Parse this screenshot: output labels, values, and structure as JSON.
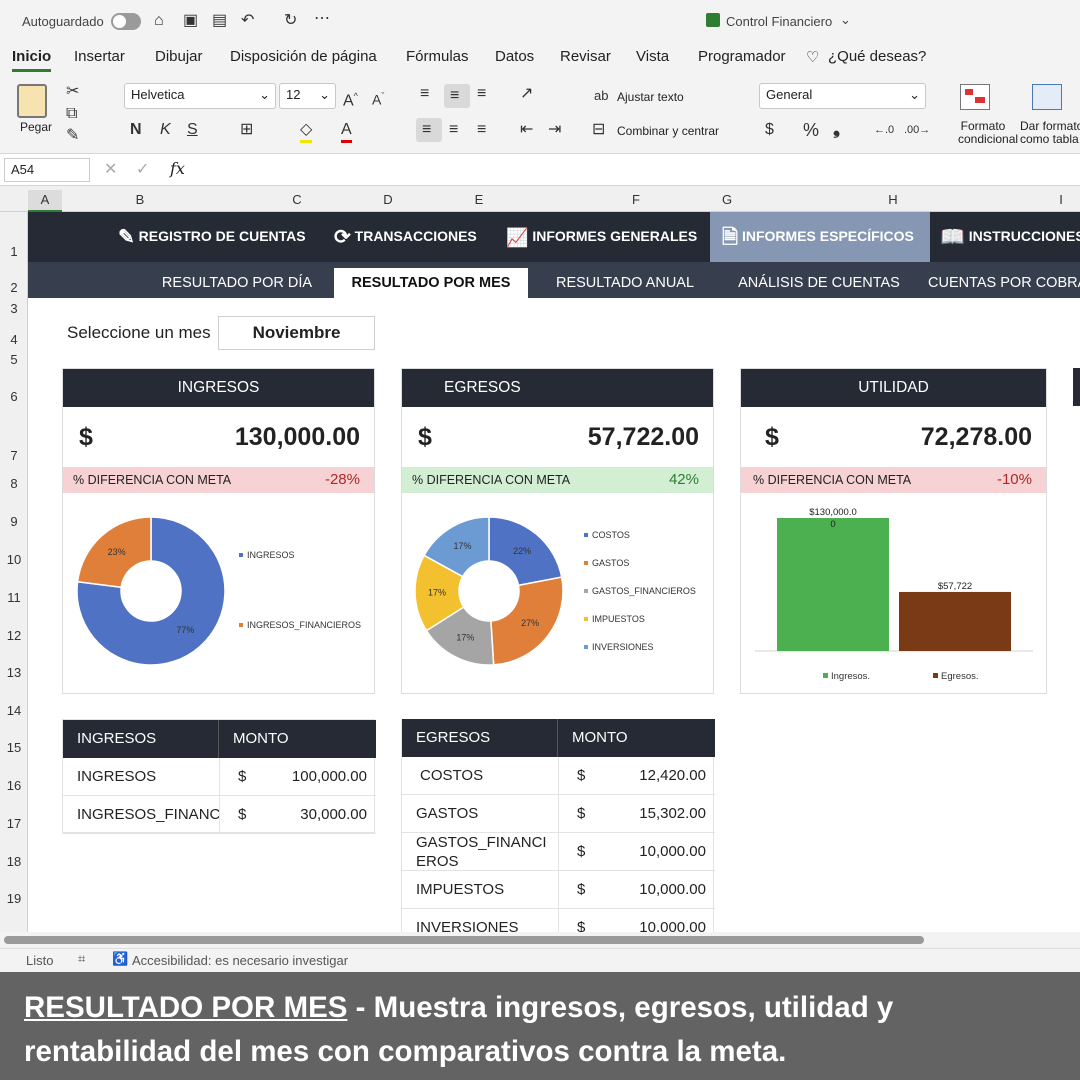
{
  "titlebar": {
    "autosave": "Autoguardado",
    "doc_title": "Control Financiero"
  },
  "tabs": [
    "Inicio",
    "Insertar",
    "Dibujar",
    "Disposición de página",
    "Fórmulas",
    "Datos",
    "Revisar",
    "Vista",
    "Programador",
    "¿Qué deseas?"
  ],
  "ribbon": {
    "paste": "Pegar",
    "font": "Helvetica",
    "size": "12",
    "bold": "N",
    "italic": "K",
    "underline": "S",
    "wrap": "Ajustar texto",
    "merge": "Combinar y centrar",
    "format": "General",
    "currency": "$",
    "percent": "%",
    "comma": "❟",
    "cond1": "Formato",
    "cond2": "condicional",
    "table1": "Dar formato",
    "table2": "como tabla"
  },
  "formula": {
    "cell_ref": "A54",
    "fx": "fx"
  },
  "columns": [
    "A",
    "B",
    "C",
    "D",
    "E",
    "F",
    "G",
    "H",
    "I"
  ],
  "rows": [
    "1",
    "2",
    "3",
    "4",
    "5",
    "6",
    "7",
    "8",
    "9",
    "10",
    "11",
    "12",
    "13",
    "14",
    "15",
    "16",
    "17",
    "18",
    "19"
  ],
  "nav_main": [
    "REGISTRO DE CUENTAS",
    "TRANSACCIONES",
    "INFORMES GENERALES",
    "INFORMES ESPECÍFICOS",
    "INSTRUCCIONES"
  ],
  "nav_sub": [
    "RESULTADO POR DÍA",
    "RESULTADO POR MES",
    "RESULTADO ANUAL",
    "ANÁLISIS DE CUENTAS",
    "CUENTAS POR COBRAR"
  ],
  "month": {
    "label": "Seleccione un mes",
    "value": "Noviembre"
  },
  "cards": [
    {
      "title": "INGRESOS",
      "currency": "$",
      "amount": "130,000.00",
      "diff_label": "% DIFERENCIA CON META",
      "diff_value": "-28%",
      "status_color": "#f6d2d4",
      "value_color": "#b02828"
    },
    {
      "title": "EGRESOS",
      "currency": "$",
      "amount": "57,722.00",
      "diff_label": "% DIFERENCIA CON META",
      "diff_value": "42%",
      "status_color": "#d3efd3",
      "value_color": "#2e7d32"
    },
    {
      "title": "UTILIDAD",
      "currency": "$",
      "amount": "72,278.00",
      "diff_label": "% DIFERENCIA CON META",
      "diff_value": "-10%",
      "status_color": "#f6d2d4",
      "value_color": "#b02828"
    }
  ],
  "chart_data": [
    {
      "type": "pie",
      "donut": true,
      "labels": [
        "INGRESOS",
        "INGRESOS_FINANCIEROS"
      ],
      "values": [
        77,
        23
      ],
      "data_labels": [
        "77%",
        "23%"
      ],
      "colors": [
        "#4f72c4",
        "#e07f3a"
      ],
      "legend": "right"
    },
    {
      "type": "pie",
      "donut": true,
      "labels": [
        "COSTOS",
        "GASTOS",
        "GASTOS_FINANCIEROS",
        "IMPUESTOS",
        "INVERSIONES"
      ],
      "values": [
        22,
        27,
        17,
        17,
        17
      ],
      "data_labels": [
        "22%",
        "27%",
        "17%",
        "17%",
        "17%"
      ],
      "colors": [
        "#4f72c4",
        "#e07f3a",
        "#a5a5a5",
        "#f3c12f",
        "#6b9bd2"
      ],
      "legend": "right"
    },
    {
      "type": "bar",
      "categories": [
        "Ingresos.",
        "Egresos."
      ],
      "values": [
        130000,
        57722
      ],
      "data_labels": [
        "$130,000.0\n0",
        "$57,722"
      ],
      "colors": [
        "#4caf50",
        "#7b3a16"
      ],
      "legend": "bottom"
    }
  ],
  "table_ingresos": {
    "headers": [
      "INGRESOS",
      "MONTO"
    ],
    "rows": [
      [
        "INGRESOS",
        "$",
        "100,000.00"
      ],
      [
        "INGRESOS_FINANC",
        "$",
        "30,000.00"
      ]
    ]
  },
  "table_egresos": {
    "headers": [
      "EGRESOS",
      "MONTO"
    ],
    "rows": [
      [
        "COSTOS",
        "$",
        "12,420.00"
      ],
      [
        "GASTOS",
        "$",
        "15,302.00"
      ],
      [
        "GASTOS_FINANCI\nEROS",
        "$",
        "10,000.00"
      ],
      [
        "IMPUESTOS",
        "$",
        "10,000.00"
      ],
      [
        "INVERSIONES",
        "$",
        "10,000.00"
      ]
    ]
  },
  "status": {
    "ready": "Listo",
    "accessibility": "Accesibilidad: es necesario investigar"
  },
  "caption": {
    "title": "RESULTADO POR MES",
    "text": " - Muestra ingresos, egresos, utilidad y rentabilidad del mes con comparativos contra la meta."
  }
}
